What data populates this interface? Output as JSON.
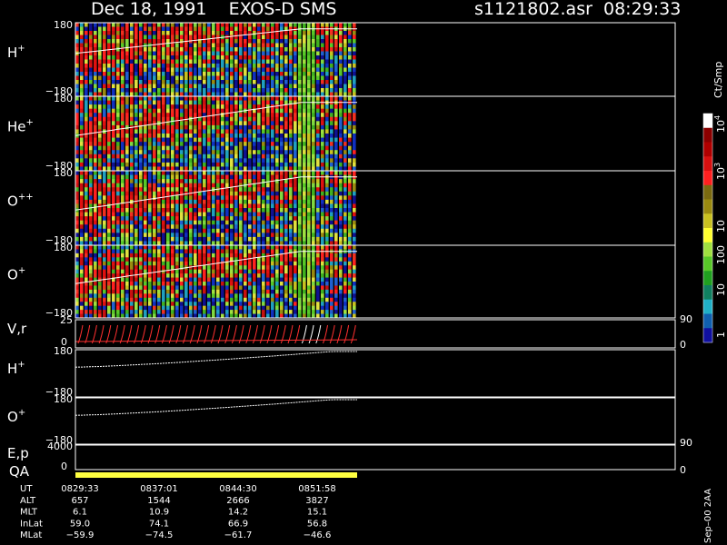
{
  "header": {
    "title": "Dec 18, 1991    EXOS-D SMS",
    "file_time": "s1121802.asr  08:29:33"
  },
  "colorbar": {
    "unit": "Ct/Smp",
    "tick_labels": [
      "10",
      "10",
      "10",
      "100",
      "10",
      "1"
    ],
    "tick_superscripts": [
      "4",
      "3",
      "",
      "",
      "",
      ""
    ],
    "colors": [
      "#ffffff",
      "#8b0000",
      "#b00000",
      "#d81010",
      "#ff2020",
      "#7a6a10",
      "#9a8a10",
      "#c8c020",
      "#ffff30",
      "#a0e040",
      "#58c828",
      "#20a020",
      "#108060",
      "#20b0c8",
      "#1060b0",
      "#1010a0"
    ]
  },
  "panels": [
    {
      "id": "hplus",
      "name": "H",
      "sup": "+",
      "ytop": "180",
      "ybot": "−180"
    },
    {
      "id": "heplus",
      "name": "He",
      "sup": "+",
      "ytop": "180",
      "ybot": "−180"
    },
    {
      "id": "oplusplus",
      "name": "O",
      "sup": "++",
      "ytop": "180",
      "ybot": "−180"
    },
    {
      "id": "oplus",
      "name": "O",
      "sup": "+",
      "ytop": "180",
      "ybot": "−180"
    }
  ],
  "vr_panel": {
    "name": "V,r",
    "ytop": "25",
    "ybot": "0",
    "right_top": "90",
    "right_bot": "0"
  },
  "line_panels": [
    {
      "id": "hplus_line",
      "name": "H",
      "sup": "+",
      "ytop": "180",
      "ybot": "−180"
    },
    {
      "id": "oplus_line",
      "name": "O",
      "sup": "+",
      "ytop": "180",
      "ybot": "−180"
    }
  ],
  "ep_panel": {
    "name": "E,p",
    "ytop": "4000",
    "ybot": "0",
    "right_top": "90",
    "right_bot": "0"
  },
  "qa_label": "QA",
  "stats": {
    "rows": [
      {
        "label": "UT",
        "values": [
          "0829:33",
          "0837:01",
          "0844:30",
          "0851:58"
        ]
      },
      {
        "label": "ALT",
        "values": [
          "657",
          "1544",
          "2666",
          "3827"
        ]
      },
      {
        "label": "MLT",
        "values": [
          "6.1",
          "10.9",
          "14.2",
          "15.1"
        ]
      },
      {
        "label": "InLat",
        "values": [
          "59.0",
          "74.1",
          "66.9",
          "56.8"
        ]
      },
      {
        "label": "MLat",
        "values": [
          "−59.9",
          "−74.5",
          "−61.7",
          "−46.6"
        ]
      }
    ]
  },
  "footer_code": "Sep–00  2AA",
  "chart_data": {
    "type": "heatmap",
    "title": "Dec 18, 1991    EXOS-D SMS",
    "x_ticks": [
      "0829:33",
      "0837:01",
      "0844:30",
      "0851:58"
    ],
    "spin_phase_range": [
      -180,
      180
    ],
    "vr_range": [
      0,
      25
    ],
    "ep_range": [
      0,
      4000
    ],
    "colorbar_unit": "Ct/Smp",
    "colorbar_range": [
      1,
      10000
    ],
    "series": [
      {
        "name": "H+",
        "trace_start": 30,
        "trace_end": 150
      },
      {
        "name": "He+",
        "trace_start": -10,
        "trace_end": 150
      },
      {
        "name": "O++",
        "trace_start": -10,
        "trace_end": 150
      },
      {
        "name": "O+",
        "trace_start": -10,
        "trace_end": 150
      }
    ]
  }
}
